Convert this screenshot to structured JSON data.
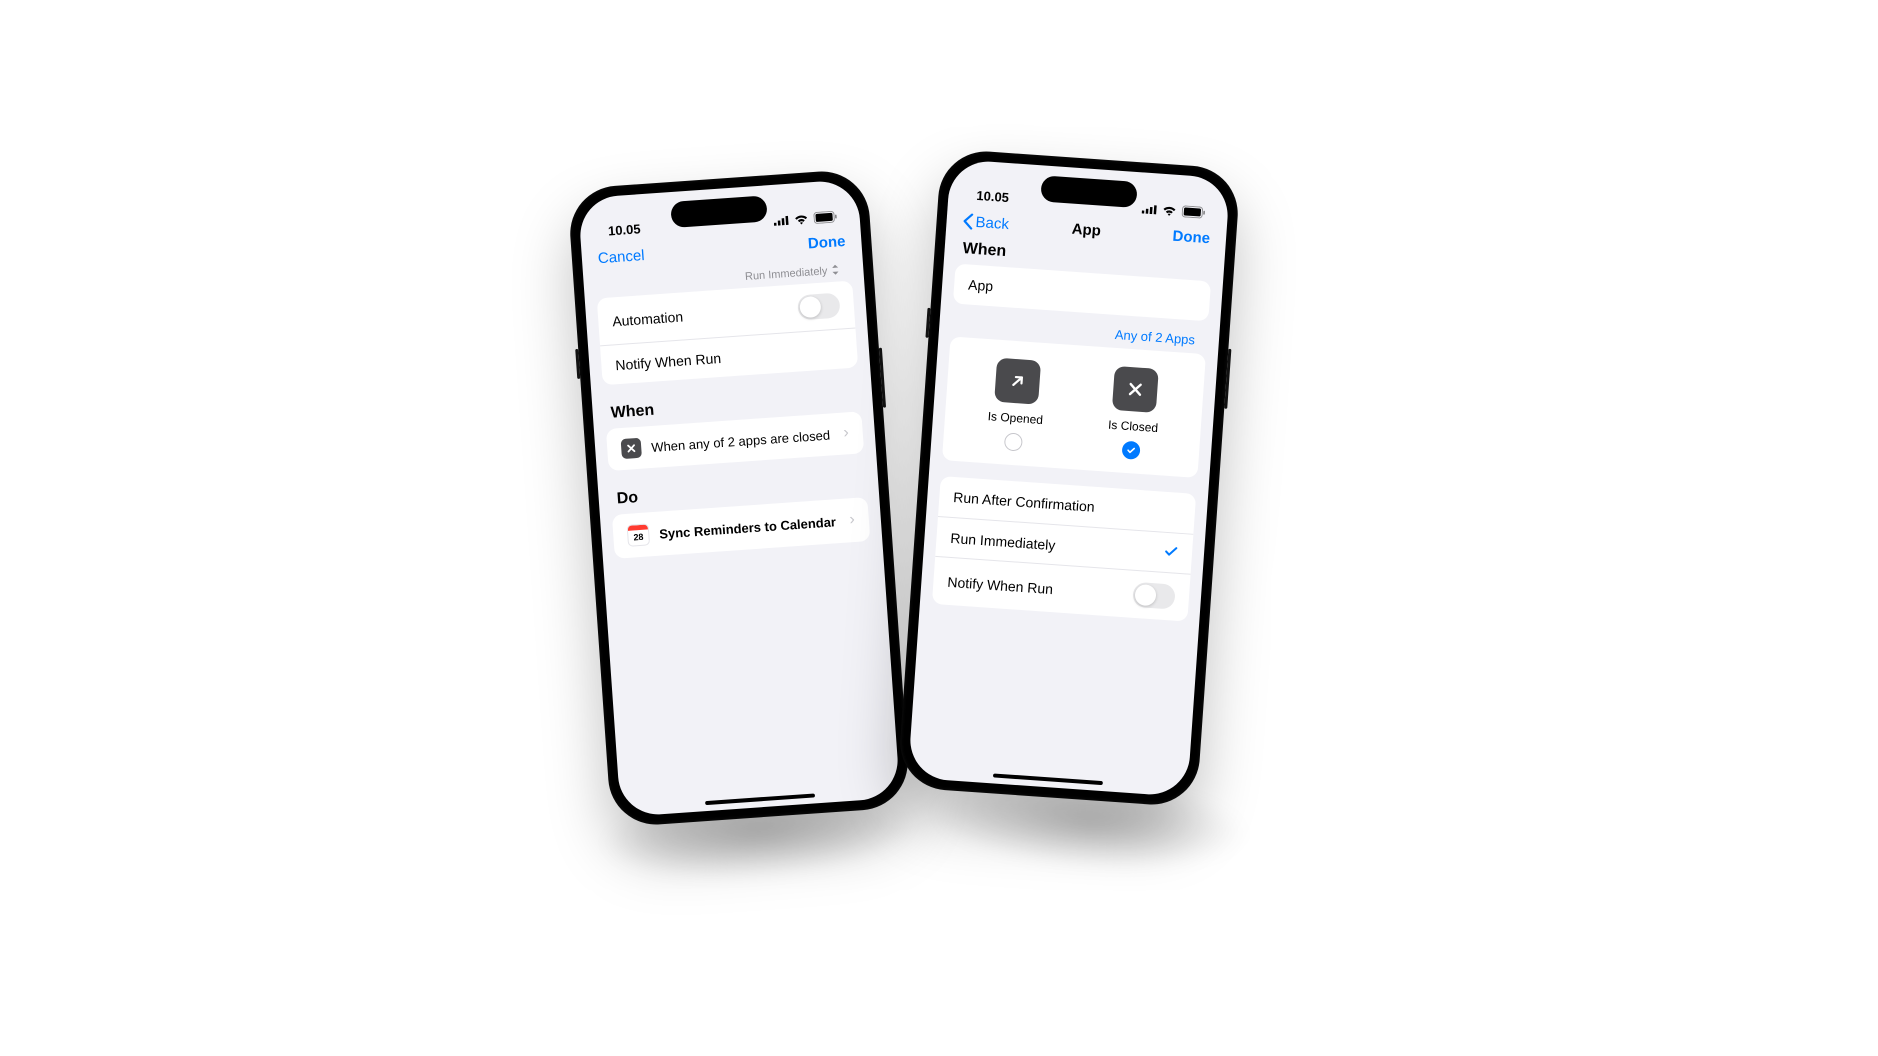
{
  "colors": {
    "accent": "#007aff",
    "bg": "#f2f2f7"
  },
  "phone1": {
    "status_time": "10.05",
    "nav": {
      "cancel": "Cancel",
      "done": "Done"
    },
    "run_mode_label": "Run Immediately",
    "rows": {
      "automation": "Automation",
      "notify": "Notify When Run"
    },
    "when": {
      "title": "When",
      "desc": "When any of 2 apps are closed"
    },
    "do": {
      "title": "Do",
      "action": "Sync Reminders to Calendar"
    }
  },
  "phone2": {
    "status_time": "10.05",
    "nav": {
      "back": "Back",
      "title": "App",
      "done": "Done"
    },
    "when_title": "When",
    "app_row_label": "App",
    "app_link": "Any of 2 Apps",
    "choices": {
      "opened": {
        "label": "Is Opened",
        "checked": false
      },
      "closed": {
        "label": "Is Closed",
        "checked": true
      }
    },
    "options": {
      "confirm": "Run After Confirmation",
      "immediate": "Run Immediately",
      "notify": "Notify When Run"
    }
  }
}
